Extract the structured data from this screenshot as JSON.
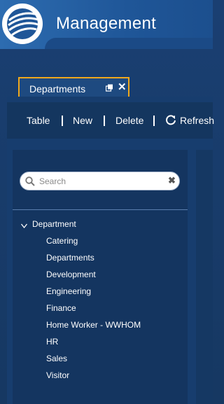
{
  "header": {
    "title": "Management",
    "logo": "globe-logo-icon"
  },
  "tab": {
    "label": "Departments",
    "icons": [
      "pin-icon",
      "close-icon"
    ],
    "accent_color": "#f0a81c"
  },
  "toolbar": {
    "items": [
      {
        "label": "Table"
      },
      {
        "label": "New"
      },
      {
        "label": "Delete"
      },
      {
        "label": "Refresh",
        "icon": "refresh-icon"
      }
    ]
  },
  "search": {
    "value": "",
    "placeholder": "Search"
  },
  "tree": {
    "root": {
      "label": "Department",
      "expanded": true
    },
    "children": [
      {
        "label": "Catering"
      },
      {
        "label": "Departments"
      },
      {
        "label": "Development"
      },
      {
        "label": "Engineering"
      },
      {
        "label": "Finance"
      },
      {
        "label": "Home Worker - WWHOM"
      },
      {
        "label": "HR"
      },
      {
        "label": "Sales"
      },
      {
        "label": "Visitor"
      }
    ]
  },
  "colors": {
    "background": "#1a3f72",
    "header": "#2d6cb0",
    "panel": "#173d6e"
  }
}
